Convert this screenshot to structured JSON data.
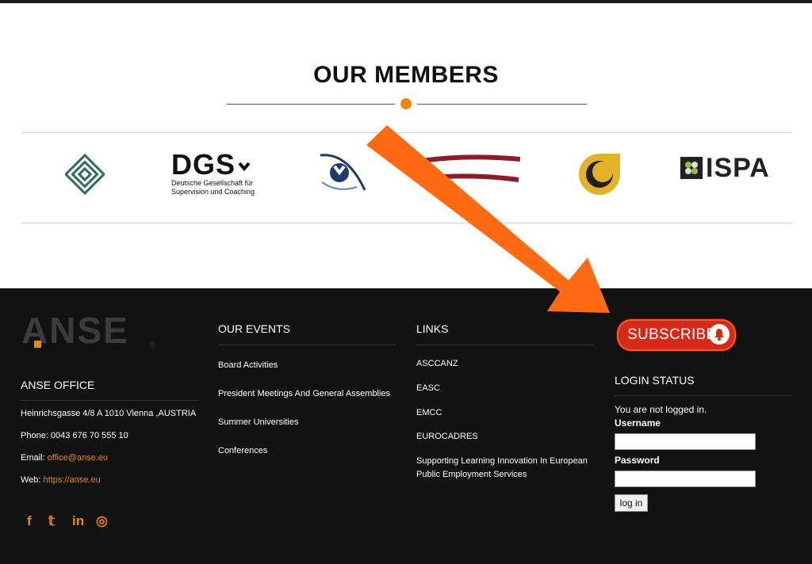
{
  "members": {
    "title": "OUR MEMBERS",
    "logos": {
      "dgs": {
        "brand": "DGS",
        "line1": "Deutsche Gesellschaft für",
        "line2": "Supervision und Coaching"
      },
      "ispa": {
        "brand": "ISPA"
      }
    }
  },
  "footer": {
    "logo": {
      "text": "ANSE",
      "reg": "®"
    },
    "office": {
      "heading": "ANSE OFFICE",
      "address": "Heinrichsgasse 4/8 A 1010 Vienna ,AUSTRIA",
      "phone": "Phone: 0043 676 70 555 10",
      "email_label": "Email: ",
      "email": "office@anse.eu",
      "web_label": "Web: ",
      "web": "https://anse.eu"
    },
    "social": {
      "facebook": "f",
      "twitter": "𝕥",
      "linkedin": "in",
      "instagram": "◎"
    },
    "events": {
      "heading": "OUR EVENTS",
      "items": [
        "Board Activities",
        "President Meetings And General Assemblies",
        "Summer Universities",
        "Conferences"
      ]
    },
    "links": {
      "heading": "LINKS",
      "items": [
        "ASCCANZ",
        "EASC",
        "EMCC",
        "EUROCADRES",
        "Supporting Learning Innovation In European",
        "Public Employment Services"
      ]
    },
    "subscribe": {
      "label": "SUBSCRIBE"
    },
    "login": {
      "heading": "LOGIN STATUS",
      "status": "You are not logged in.",
      "username_label": "Username",
      "password_label": "Password",
      "username_value": "",
      "password_value": "",
      "button": "log in"
    }
  },
  "colors": {
    "accent": "#e8861a",
    "footer_bg": "#121212",
    "subscribe_red": "#d62a18",
    "annotation_arrow": "#ff6a13"
  },
  "icons": [
    "facebook-icon",
    "twitter-icon",
    "linkedin-icon",
    "instagram-icon",
    "bell-icon",
    "annotation-arrow-icon"
  ]
}
